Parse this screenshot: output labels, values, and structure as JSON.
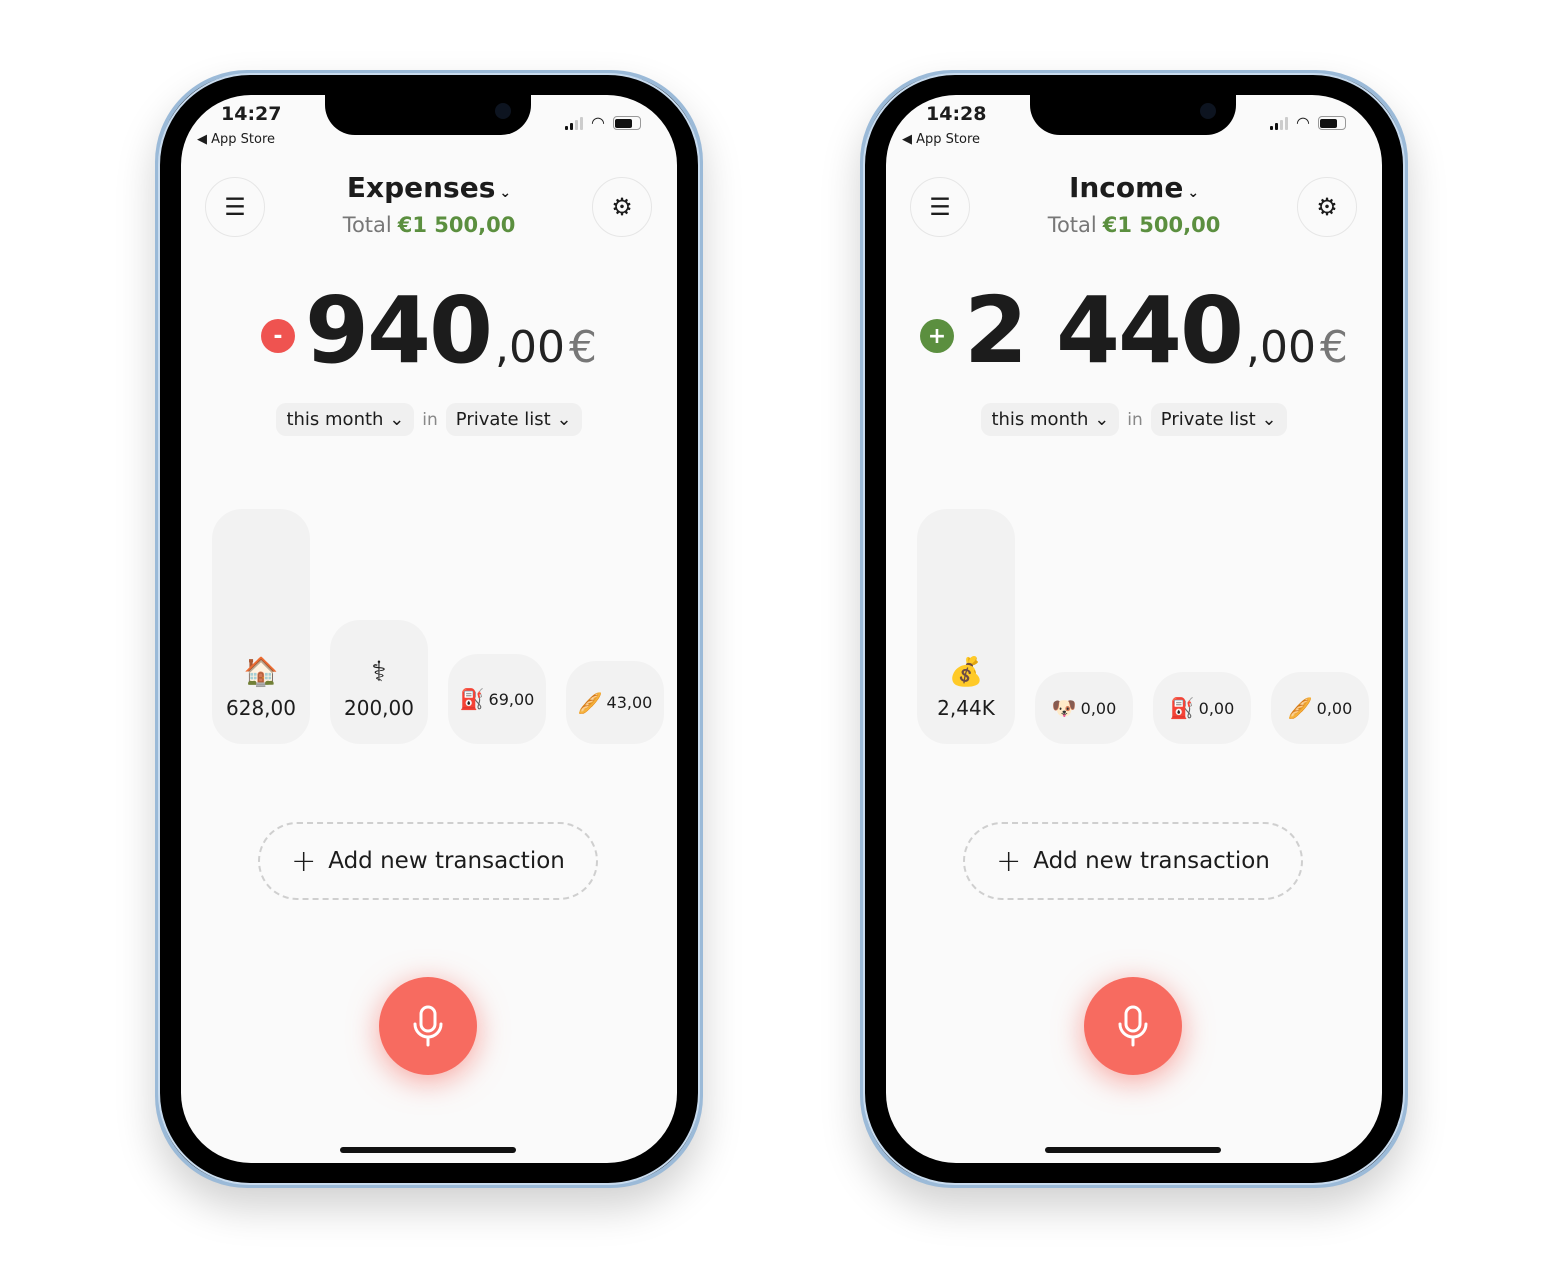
{
  "phones": [
    {
      "time": "14:27",
      "back": "◀ App Store",
      "title": "Expenses",
      "total_label": "Total",
      "total_value": "€1 500,00",
      "sign": "-",
      "sign_color": "#ef5350",
      "amount_int": "940",
      "amount_dec": ",00",
      "currency": "€",
      "period": "this month",
      "in": "in",
      "list": "Private list",
      "categories": [
        {
          "icon": "house-icon",
          "emoji": "🏠",
          "label": "628,00",
          "value": 628
        },
        {
          "icon": "medical-icon",
          "emoji": "⚕",
          "label": "200,00",
          "value": 200
        },
        {
          "icon": "fuel-pump-icon",
          "emoji": "⛽",
          "label": "69,00",
          "value": 69
        },
        {
          "icon": "bread-icon",
          "emoji": "🥖",
          "label": "43,00",
          "value": 43
        }
      ],
      "add_label": "Add new transaction"
    },
    {
      "time": "14:28",
      "back": "◀ App Store",
      "title": "Income",
      "total_label": "Total",
      "total_value": "€1 500,00",
      "sign": "+",
      "sign_color": "#5b8f3f",
      "amount_int": "2 440",
      "amount_dec": ",00",
      "currency": "€",
      "period": "this month",
      "in": "in",
      "list": "Private list",
      "categories": [
        {
          "icon": "money-bag-icon",
          "emoji": "💰",
          "label": "2,44K",
          "value": 2440
        },
        {
          "icon": "dog-icon",
          "emoji": "🐶",
          "label": "0,00",
          "value": 0
        },
        {
          "icon": "fuel-pump-icon",
          "emoji": "⛽",
          "label": "0,00",
          "value": 0
        },
        {
          "icon": "bread-icon",
          "emoji": "🥖",
          "label": "0,00",
          "value": 0
        }
      ],
      "add_label": "Add new transaction"
    }
  ],
  "colors": {
    "accent_green": "#5b8f3f",
    "mic": "#f76b60"
  }
}
